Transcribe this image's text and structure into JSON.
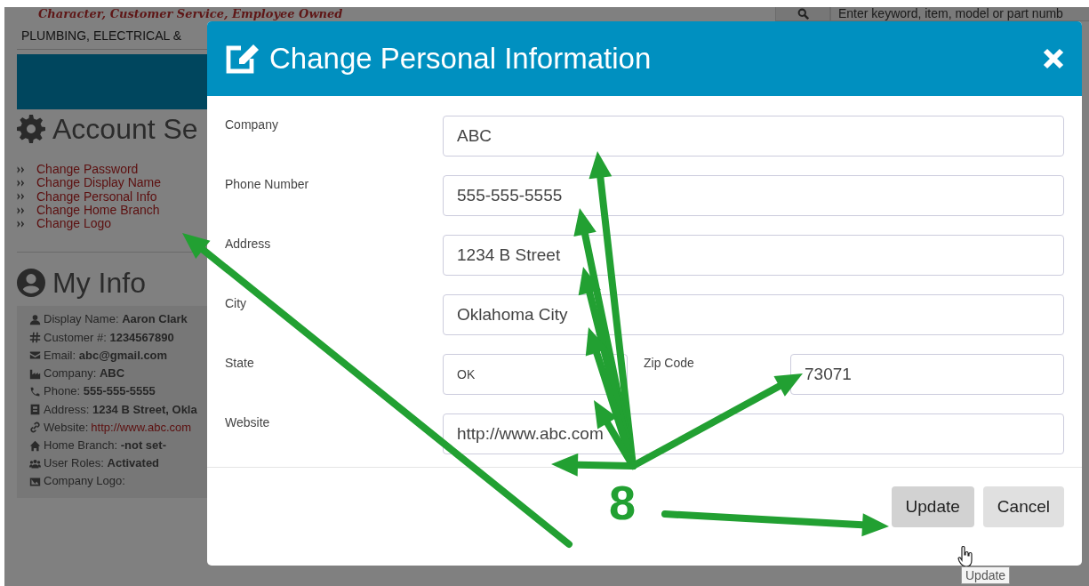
{
  "header": {
    "tagline": "Character, Customer Service, Employee Owned",
    "category_text": "PLUMBING, ELECTRICAL &",
    "search": {
      "placeholder": "Enter keyword, item, model or part numb"
    }
  },
  "account_settings": {
    "title": "Account Se",
    "links": [
      {
        "label": "Change Password"
      },
      {
        "label": "Change Display Name"
      },
      {
        "label": "Change Personal Info"
      },
      {
        "label": "Change Home Branch"
      },
      {
        "label": "Change Logo"
      }
    ]
  },
  "my_info": {
    "title": "My Info",
    "rows": [
      {
        "kind": "user",
        "label": "Display Name:",
        "value": "Aaron Clark"
      },
      {
        "kind": "hash",
        "label": "Customer #:",
        "value": "1234567890"
      },
      {
        "kind": "envelope",
        "label": "Email:",
        "value": "abc@gmail.com"
      },
      {
        "kind": "industry",
        "label": "Company:",
        "value": "ABC"
      },
      {
        "kind": "phone",
        "label": "Phone:",
        "value": "555-555-5555"
      },
      {
        "kind": "card",
        "label": "Address:",
        "value": "1234 B Street, Okla"
      },
      {
        "kind": "link",
        "label": "Website:",
        "value": "http://www.abc.com"
      },
      {
        "kind": "home",
        "label": "Home Branch:",
        "value": "-not set-"
      },
      {
        "kind": "users",
        "label": "User Roles:",
        "value": "Activated"
      },
      {
        "kind": "image",
        "label": "Company Logo:"
      }
    ]
  },
  "modal": {
    "title": "Change Personal Information",
    "rows": [
      [
        {
          "label": "Company",
          "value": "ABC",
          "kind": "text"
        }
      ],
      [
        {
          "label": "Phone Number",
          "value": "555-555-5555",
          "kind": "text"
        }
      ],
      [
        {
          "label": "Address",
          "value": "1234 B Street",
          "kind": "text"
        }
      ],
      [
        {
          "label": "City",
          "value": "Oklahoma City",
          "kind": "text"
        }
      ],
      [
        {
          "label": "State",
          "value": "OK",
          "kind": "select"
        },
        {
          "label": "Zip Code",
          "value": "73071",
          "kind": "text"
        }
      ],
      [
        {
          "label": "Website",
          "value": "http://www.abc.com",
          "kind": "text"
        }
      ]
    ],
    "buttons": [
      {
        "label": "Update",
        "hovered": true
      },
      {
        "label": "Cancel",
        "hovered": false
      }
    ],
    "tooltip": "Update"
  },
  "annotation": {
    "step": "8"
  }
}
